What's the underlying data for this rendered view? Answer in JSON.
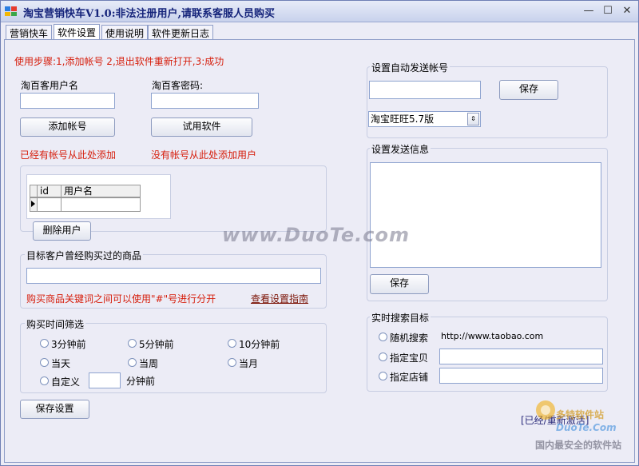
{
  "window": {
    "title": "淘宝营销快车V1.0:非法注册用户,请联系客服人员购买",
    "controls": [
      "—",
      "☐",
      "✕"
    ]
  },
  "tabs": [
    {
      "label": "营销快车",
      "active": false
    },
    {
      "label": "软件设置",
      "active": true
    },
    {
      "label": "使用说明",
      "active": false
    },
    {
      "label": "软件更新日志",
      "active": false
    }
  ],
  "left": {
    "steps": "使用步骤:1,添加帐号 2,退出软件重新打开,3:成功",
    "username_label": "淘百客用户名",
    "username_value": "",
    "password_label": "淘百客密码:",
    "password_value": "",
    "add_account_button": "添加帐号",
    "trial_button": "试用软件",
    "has_account_hint": "已经有帐号从此处添加",
    "no_account_hint": "没有帐号从此处添加用户",
    "grid_columns": [
      "id",
      "用户名"
    ],
    "delete_user_button": "删除用户",
    "products_group_title": "目标客户曾经购买过的商品",
    "products_value": "",
    "keyword_hint": "购买商品关键词之间可以使用\"#\"号进行分开",
    "guide_link": "查看设置指南",
    "time_group_title": "购买时间筛选",
    "time_options": [
      "3分钟前",
      "5分钟前",
      "10分钟前",
      "当天",
      "当周",
      "当月",
      "自定义"
    ],
    "custom_suffix": "分钟前",
    "custom_value": "",
    "save_settings_button": "保存设置"
  },
  "right": {
    "auto_account_title": "设置自动发送帐号",
    "auto_account_value": "",
    "save_button": "保存",
    "client_select": "淘宝旺旺5.7版",
    "message_title": "设置发送信息",
    "message_value": "",
    "message_save_button": "保存",
    "realtime_title": "实时搜索目标",
    "random_search_label": "随机搜索",
    "random_search_url": "http://www.taobao.com",
    "item_label": "指定宝贝",
    "item_value": "",
    "shop_label": "指定店铺",
    "shop_value": ""
  },
  "footer": {
    "status_link": "[已经/重新激活]"
  },
  "watermarks": {
    "main": "www.DuoTe.com",
    "logo_cn": "多特软件站",
    "logo_en": "DuoTe.Com",
    "logo_slogan": "国内最安全的软件站"
  }
}
